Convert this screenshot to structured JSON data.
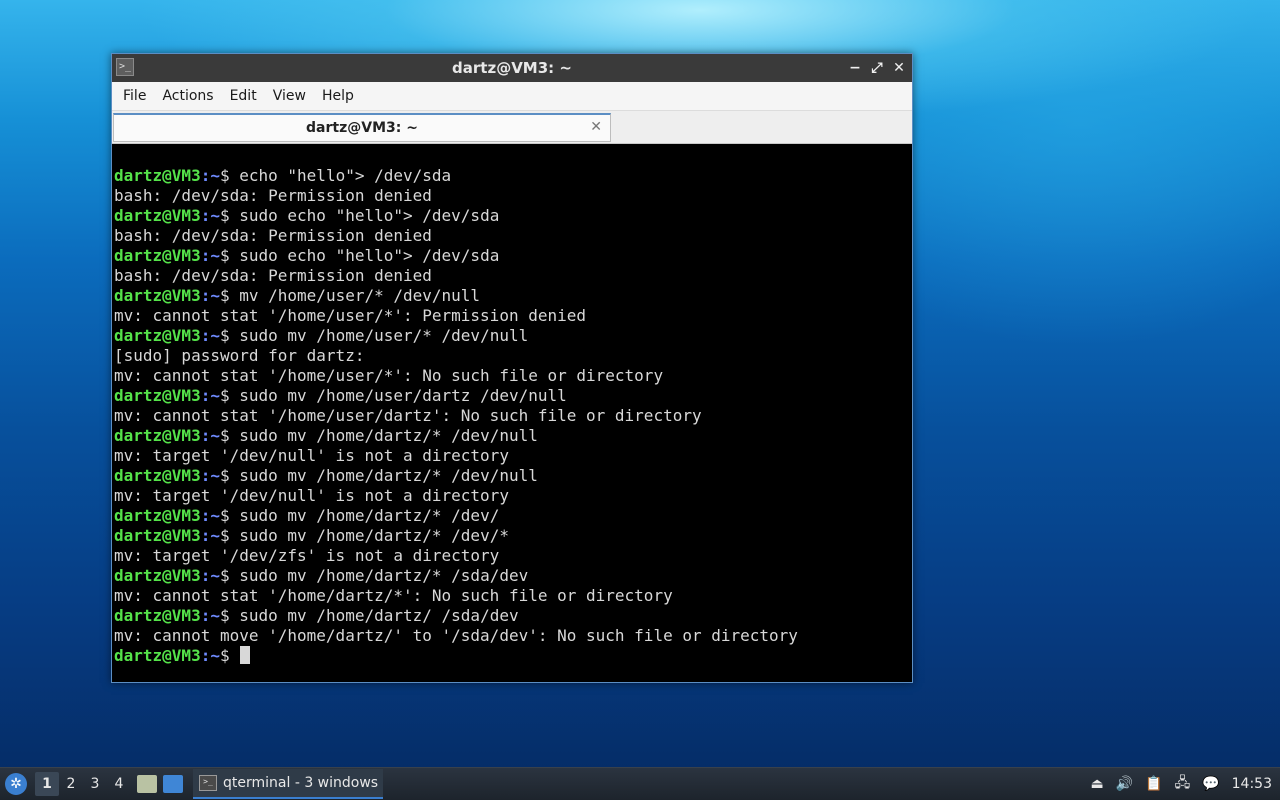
{
  "window": {
    "title": "dartz@VM3: ~",
    "controls": {
      "minimize": "−",
      "maximize": "⤢",
      "close": "✕"
    }
  },
  "menu": [
    "File",
    "Actions",
    "Edit",
    "View",
    "Help"
  ],
  "tab": {
    "title": "dartz@VM3: ~",
    "close": "✕"
  },
  "terminal": {
    "prompt_user": "dartz@VM3",
    "prompt_path": ":~",
    "prompt_symbol": "$",
    "lines": [
      {
        "type": "cmd",
        "text": " echo \"hello\"> /dev/sda"
      },
      {
        "type": "out",
        "text": "bash: /dev/sda: Permission denied"
      },
      {
        "type": "cmd",
        "text": " sudo echo \"hello\"> /dev/sda"
      },
      {
        "type": "out",
        "text": "bash: /dev/sda: Permission denied"
      },
      {
        "type": "cmd",
        "text": " sudo echo \"hello\"> /dev/sda"
      },
      {
        "type": "out",
        "text": "bash: /dev/sda: Permission denied"
      },
      {
        "type": "cmd",
        "text": " mv /home/user/* /dev/null"
      },
      {
        "type": "out",
        "text": "mv: cannot stat '/home/user/*': Permission denied"
      },
      {
        "type": "cmd",
        "text": " sudo mv /home/user/* /dev/null"
      },
      {
        "type": "out",
        "text": "[sudo] password for dartz:"
      },
      {
        "type": "out",
        "text": "mv: cannot stat '/home/user/*': No such file or directory"
      },
      {
        "type": "cmd",
        "text": " sudo mv /home/user/dartz /dev/null"
      },
      {
        "type": "out",
        "text": "mv: cannot stat '/home/user/dartz': No such file or directory"
      },
      {
        "type": "cmd",
        "text": " sudo mv /home/dartz/* /dev/null"
      },
      {
        "type": "out",
        "text": "mv: target '/dev/null' is not a directory"
      },
      {
        "type": "cmd",
        "text": " sudo mv /home/dartz/* /dev/null"
      },
      {
        "type": "out",
        "text": "mv: target '/dev/null' is not a directory"
      },
      {
        "type": "cmd",
        "text": " sudo mv /home/dartz/* /dev/"
      },
      {
        "type": "cmd",
        "text": " sudo mv /home/dartz/* /dev/*"
      },
      {
        "type": "out",
        "text": "mv: target '/dev/zfs' is not a directory"
      },
      {
        "type": "cmd",
        "text": " sudo mv /home/dartz/* /sda/dev"
      },
      {
        "type": "out",
        "text": "mv: cannot stat '/home/dartz/*': No such file or directory"
      },
      {
        "type": "cmd",
        "text": " sudo mv /home/dartz/ /sda/dev"
      },
      {
        "type": "out",
        "text": "mv: cannot move '/home/dartz/' to '/sda/dev': No such file or directory"
      },
      {
        "type": "cmd",
        "text": ""
      }
    ]
  },
  "taskbar": {
    "start_icon": "lxqt-start-icon",
    "desktops": [
      "1",
      "2",
      "3",
      "4"
    ],
    "active_desktop": "1",
    "quicklaunch": [
      {
        "icon": "file-manager-icon",
        "color": "#b9c2a3"
      },
      {
        "icon": "show-desktop-icon",
        "color": "#3f86d6"
      }
    ],
    "task_label": "qterminal - 3 windows",
    "tray": {
      "eject": "⏏",
      "volume": "🔊",
      "clipboard": "📋",
      "network": "🖧",
      "notifier": "💬"
    },
    "clock": "14:53"
  }
}
